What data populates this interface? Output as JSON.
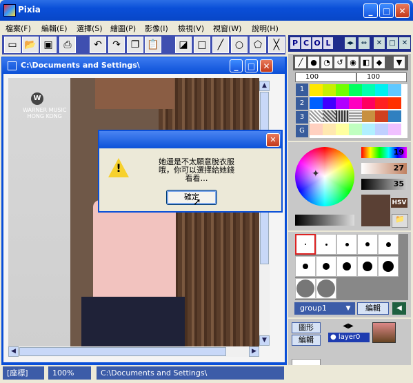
{
  "window": {
    "title": "Pixia",
    "minimize": "_",
    "maximize": "□",
    "close": "✕"
  },
  "menu": [
    "檔案(F)",
    "編輯(E)",
    "選擇(S)",
    "繪圖(P)",
    "影像(I)",
    "檢視(V)",
    "視窗(W)",
    "說明(H)"
  ],
  "right_toolbar": {
    "pcol": [
      "P",
      "C",
      "O",
      "L"
    ]
  },
  "document": {
    "title": "C:\\Documents and Settings\\",
    "watermark": "WARNER MUSIC\nHONG KONG",
    "logo_letter": "W"
  },
  "dialog": {
    "close": "✕",
    "message": "她還是不太願意脫衣服\n哦，你可以選擇給她錢\n看看…",
    "ok": "確定"
  },
  "pen": {
    "opacity1": "100",
    "opacity2": "100"
  },
  "palette_tabs": [
    "1",
    "2",
    "3",
    "G"
  ],
  "color": {
    "hue": "19",
    "sat": "27",
    "val": "35",
    "mode": "HSV",
    "current": "#5a4034"
  },
  "layers": {
    "group": "group1",
    "edit": "編輯",
    "shape_btn": "圖形",
    "edit_btn": "編輯",
    "layer_name": "layer0",
    "arrows": "◀▶"
  },
  "status": {
    "coord": "[座標]",
    "zoom": "100%",
    "path": "C:\\Documents and Settings\\"
  }
}
